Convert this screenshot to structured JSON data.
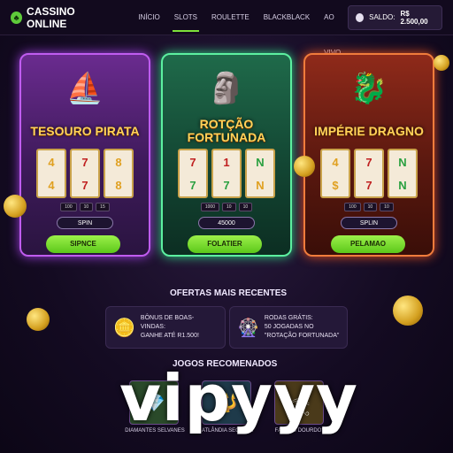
{
  "nav": {
    "brand": "CASSINO ONLINE",
    "items": [
      {
        "label": "INÍCIO",
        "active": false
      },
      {
        "label": "SLOTS",
        "active": true
      },
      {
        "label": "ROULETTE",
        "active": false
      },
      {
        "label": "BLACKBLACK",
        "active": false
      },
      {
        "label": "AO VIVO",
        "active": false
      }
    ],
    "balance_label": "SALDO:",
    "balance_value": "R$ 2.500,00"
  },
  "games": [
    {
      "title": "TESOURO PIRATA",
      "art_icon": "pirate-ship-icon",
      "reels": [
        [
          "4",
          "4"
        ],
        [
          "7",
          "7"
        ],
        [
          "8",
          "8"
        ]
      ],
      "bets": [
        "100",
        "10",
        "15"
      ],
      "spin_label": "SPIN",
      "play_label": "SIPNCE"
    },
    {
      "title": "ROTÇÃO FORTUNADA",
      "art_icon": "golden-idol-icon",
      "reels": [
        [
          "7",
          "7"
        ],
        [
          "1",
          "7"
        ],
        [
          "N",
          "N"
        ]
      ],
      "bets": [
        "1000",
        "10",
        "10"
      ],
      "spin_label": "45000",
      "play_label": "FOLATIER"
    },
    {
      "title": "IMPÉRIE DRAGNO",
      "art_icon": "dragon-icon",
      "reels": [
        [
          "4",
          "$"
        ],
        [
          "7",
          "7"
        ],
        [
          "N",
          "N"
        ]
      ],
      "bets": [
        "100",
        "10",
        "10"
      ],
      "spin_label": "SPLIN",
      "play_label": "PELAMAO"
    }
  ],
  "offers": {
    "title": "OFERTAS MAIS RECENTES",
    "items": [
      {
        "icon": "coins-icon",
        "line1": "BÔNUS DE BOAS-VINDAS:",
        "line2": "GANHE ATÉ R1.500!"
      },
      {
        "icon": "wheel-icon",
        "line1": "RODAS GRÁTIS:",
        "line2": "50 JOGADAS NO",
        "line3": "\"ROTAÇÃO FORTUNADA\""
      }
    ]
  },
  "recommended": {
    "title": "JOGOS RECOMENADOS",
    "items": [
      {
        "label": "DIAMANTES SELVANES",
        "icon": "diamond-icon"
      },
      {
        "label": "ATLÂNDIA SECRETA",
        "icon": "trident-icon"
      },
      {
        "label": "FARAÓS DOURDOS",
        "icon": "pharaoh-icon"
      }
    ]
  },
  "watermark": "vipyyy",
  "colors": {
    "accent_green": "#7ee13a",
    "purple_card": "#c05cf0",
    "green_card": "#5cf0a0",
    "red_card": "#f07c3c"
  }
}
